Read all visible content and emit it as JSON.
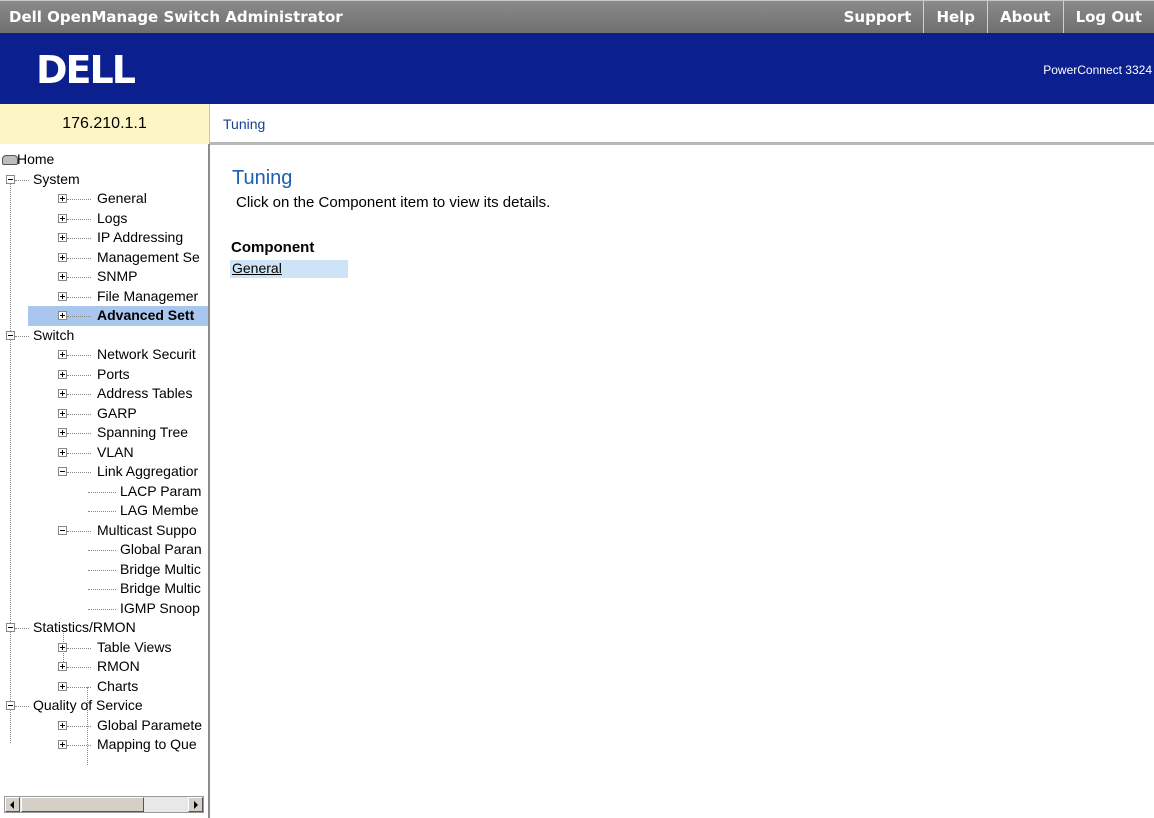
{
  "header": {
    "app_title": "Dell OpenManage Switch Administrator",
    "nav": [
      "Support",
      "Help",
      "About",
      "Log Out"
    ]
  },
  "banner": {
    "logo_text": "DELL",
    "product": "PowerConnect 3324"
  },
  "device_ip": "176.210.1.1",
  "breadcrumb": "Tuning",
  "tree": {
    "home": "Home",
    "system": "System",
    "system_children": [
      "General",
      "Logs",
      "IP Addressing",
      "Management Se",
      "SNMP",
      "File Managemer",
      "Advanced Sett"
    ],
    "switch": "Switch",
    "switch_children": [
      "Network Securit",
      "Ports",
      "Address Tables",
      "GARP",
      "Spanning Tree",
      "VLAN",
      "Link Aggregatior"
    ],
    "link_agg_children": [
      "LACP Param",
      "LAG Membe"
    ],
    "multicast": "Multicast Suppo",
    "multicast_children": [
      "Global Paran",
      "Bridge Multic",
      "Bridge Multic",
      "IGMP Snoop"
    ],
    "stats": "Statistics/RMON",
    "stats_children": [
      "Table Views",
      "RMON",
      "Charts"
    ],
    "qos": "Quality of Service",
    "qos_children": [
      "Global Paramete",
      "Mapping to Que"
    ],
    "selected": "Advanced Sett"
  },
  "content": {
    "title": "Tuning",
    "description": "Click on the Component item to view its details.",
    "component_header": "Component",
    "components": [
      "General"
    ]
  },
  "colors": {
    "banner": "#0b1f8e",
    "ip_box": "#fdf6c4",
    "title": "#1b5fae",
    "selection": "#a9c6ef"
  }
}
